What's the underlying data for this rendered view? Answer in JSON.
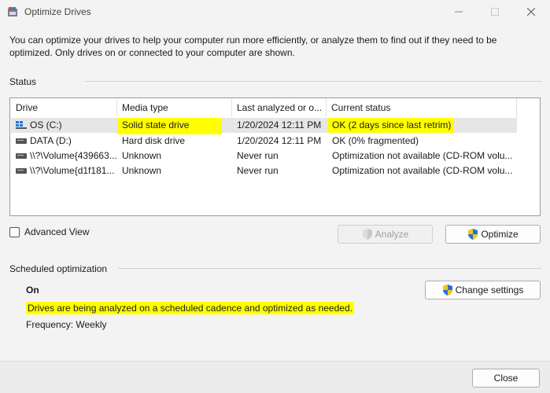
{
  "window": {
    "title": "Optimize Drives"
  },
  "intro_text": "You can optimize your drives to help your computer run more efficiently, or analyze them to find out if they need to be optimized. Only drives on or connected to your computer are shown.",
  "status_label": "Status",
  "columns": [
    "Drive",
    "Media type",
    "Last analyzed or o...",
    "Current status"
  ],
  "drives": [
    {
      "drive": "OS (C:)",
      "media": "Solid state drive",
      "last": "1/20/2024 12:11 PM",
      "status": "OK (2 days since last retrim)"
    },
    {
      "drive": "DATA (D:)",
      "media": "Hard disk drive",
      "last": "1/20/2024 12:11 PM",
      "status": "OK (0% fragmented)"
    },
    {
      "drive": "\\\\?\\Volume{439663...",
      "media": "Unknown",
      "last": "Never run",
      "status": "Optimization not available (CD-ROM volu..."
    },
    {
      "drive": "\\\\?\\Volume{d1f181...",
      "media": "Unknown",
      "last": "Never run",
      "status": "Optimization not available (CD-ROM volu..."
    }
  ],
  "advanced_view_label": "Advanced View",
  "analyze_label": "Analyze",
  "optimize_label": "Optimize",
  "scheduled": {
    "label": "Scheduled optimization",
    "state": "On",
    "description": "Drives are being analyzed on a scheduled cadence and optimized as needed.",
    "frequency": "Frequency: Weekly",
    "change_settings_label": "Change settings"
  },
  "close_label": "Close",
  "colors": {
    "highlight": "#ffff00",
    "shield_blue": "#2a6fd6",
    "shield_yellow": "#f2c811"
  }
}
